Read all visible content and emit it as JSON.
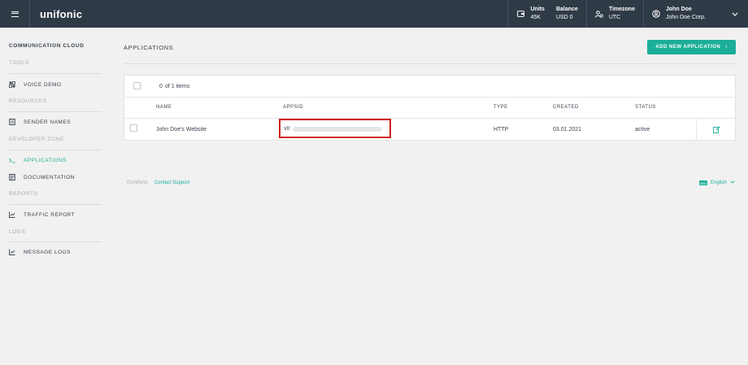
{
  "topbar": {
    "logo": "unifonic",
    "units": {
      "label": "Units",
      "value": "45K"
    },
    "balance": {
      "label": "Balance",
      "value": "USD 0"
    },
    "timezone": {
      "label": "Timezone",
      "value": "UTC"
    },
    "user": {
      "name": "John Doe",
      "company": "John Doe Corp."
    }
  },
  "sidebar": {
    "section_main": "COMMUNICATION CLOUD",
    "groups": [
      {
        "title": "TOOLS",
        "items": [
          {
            "label": "VOICE DEMO",
            "icon": "voice-demo-icon"
          }
        ]
      },
      {
        "title": "RESOURCES",
        "items": [
          {
            "label": "SENDER NAMES",
            "icon": "sender-names-icon"
          }
        ]
      },
      {
        "title": "DEVELOPER ZONE",
        "items": [
          {
            "label": "APPLICATIONS",
            "icon": "terminal-icon",
            "active": true
          },
          {
            "label": "DOCUMENTATION",
            "icon": "document-icon"
          }
        ]
      },
      {
        "title": "REPORTS",
        "items": [
          {
            "label": "TRAFFIC REPORT",
            "icon": "chart-icon"
          }
        ]
      },
      {
        "title": "LOGS",
        "items": [
          {
            "label": "MESSAGE LOGS",
            "icon": "chart-icon"
          }
        ]
      }
    ]
  },
  "main": {
    "title": "APPLICATIONS",
    "add_button": "ADD NEW APPLICATION",
    "add_button_chevron": "›",
    "table": {
      "count_value": "0",
      "count_label": "of 1 items",
      "columns": [
        "NAME",
        "APPSID",
        "TYPE",
        "CREATED",
        "STATUS"
      ],
      "rows": [
        {
          "name": "John Doe's Website",
          "appsid": "vII",
          "type": "HTTP",
          "created": "03.01.2021",
          "status": "active"
        }
      ]
    }
  },
  "footer": {
    "copyright": "©Unifonic",
    "contact": "Contact Support",
    "language": "English",
    "language_code": "AED"
  },
  "colors": {
    "accent": "#1cae99",
    "topbar": "#2f3a47",
    "highlight": "#d21f1f"
  }
}
